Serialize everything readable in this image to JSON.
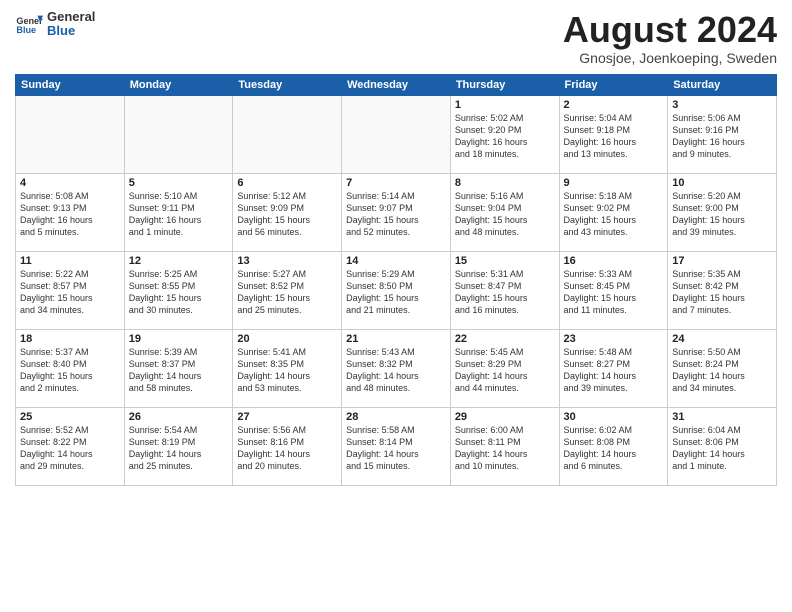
{
  "header": {
    "logo": {
      "general": "General",
      "blue": "Blue"
    },
    "title": "August 2024",
    "location": "Gnosjoe, Joenkoeping, Sweden"
  },
  "weekdays": [
    "Sunday",
    "Monday",
    "Tuesday",
    "Wednesday",
    "Thursday",
    "Friday",
    "Saturday"
  ],
  "weeks": [
    [
      {
        "day": "",
        "info": ""
      },
      {
        "day": "",
        "info": ""
      },
      {
        "day": "",
        "info": ""
      },
      {
        "day": "",
        "info": ""
      },
      {
        "day": "1",
        "info": "Sunrise: 5:02 AM\nSunset: 9:20 PM\nDaylight: 16 hours\nand 18 minutes."
      },
      {
        "day": "2",
        "info": "Sunrise: 5:04 AM\nSunset: 9:18 PM\nDaylight: 16 hours\nand 13 minutes."
      },
      {
        "day": "3",
        "info": "Sunrise: 5:06 AM\nSunset: 9:16 PM\nDaylight: 16 hours\nand 9 minutes."
      }
    ],
    [
      {
        "day": "4",
        "info": "Sunrise: 5:08 AM\nSunset: 9:13 PM\nDaylight: 16 hours\nand 5 minutes."
      },
      {
        "day": "5",
        "info": "Sunrise: 5:10 AM\nSunset: 9:11 PM\nDaylight: 16 hours\nand 1 minute."
      },
      {
        "day": "6",
        "info": "Sunrise: 5:12 AM\nSunset: 9:09 PM\nDaylight: 15 hours\nand 56 minutes."
      },
      {
        "day": "7",
        "info": "Sunrise: 5:14 AM\nSunset: 9:07 PM\nDaylight: 15 hours\nand 52 minutes."
      },
      {
        "day": "8",
        "info": "Sunrise: 5:16 AM\nSunset: 9:04 PM\nDaylight: 15 hours\nand 48 minutes."
      },
      {
        "day": "9",
        "info": "Sunrise: 5:18 AM\nSunset: 9:02 PM\nDaylight: 15 hours\nand 43 minutes."
      },
      {
        "day": "10",
        "info": "Sunrise: 5:20 AM\nSunset: 9:00 PM\nDaylight: 15 hours\nand 39 minutes."
      }
    ],
    [
      {
        "day": "11",
        "info": "Sunrise: 5:22 AM\nSunset: 8:57 PM\nDaylight: 15 hours\nand 34 minutes."
      },
      {
        "day": "12",
        "info": "Sunrise: 5:25 AM\nSunset: 8:55 PM\nDaylight: 15 hours\nand 30 minutes."
      },
      {
        "day": "13",
        "info": "Sunrise: 5:27 AM\nSunset: 8:52 PM\nDaylight: 15 hours\nand 25 minutes."
      },
      {
        "day": "14",
        "info": "Sunrise: 5:29 AM\nSunset: 8:50 PM\nDaylight: 15 hours\nand 21 minutes."
      },
      {
        "day": "15",
        "info": "Sunrise: 5:31 AM\nSunset: 8:47 PM\nDaylight: 15 hours\nand 16 minutes."
      },
      {
        "day": "16",
        "info": "Sunrise: 5:33 AM\nSunset: 8:45 PM\nDaylight: 15 hours\nand 11 minutes."
      },
      {
        "day": "17",
        "info": "Sunrise: 5:35 AM\nSunset: 8:42 PM\nDaylight: 15 hours\nand 7 minutes."
      }
    ],
    [
      {
        "day": "18",
        "info": "Sunrise: 5:37 AM\nSunset: 8:40 PM\nDaylight: 15 hours\nand 2 minutes."
      },
      {
        "day": "19",
        "info": "Sunrise: 5:39 AM\nSunset: 8:37 PM\nDaylight: 14 hours\nand 58 minutes."
      },
      {
        "day": "20",
        "info": "Sunrise: 5:41 AM\nSunset: 8:35 PM\nDaylight: 14 hours\nand 53 minutes."
      },
      {
        "day": "21",
        "info": "Sunrise: 5:43 AM\nSunset: 8:32 PM\nDaylight: 14 hours\nand 48 minutes."
      },
      {
        "day": "22",
        "info": "Sunrise: 5:45 AM\nSunset: 8:29 PM\nDaylight: 14 hours\nand 44 minutes."
      },
      {
        "day": "23",
        "info": "Sunrise: 5:48 AM\nSunset: 8:27 PM\nDaylight: 14 hours\nand 39 minutes."
      },
      {
        "day": "24",
        "info": "Sunrise: 5:50 AM\nSunset: 8:24 PM\nDaylight: 14 hours\nand 34 minutes."
      }
    ],
    [
      {
        "day": "25",
        "info": "Sunrise: 5:52 AM\nSunset: 8:22 PM\nDaylight: 14 hours\nand 29 minutes."
      },
      {
        "day": "26",
        "info": "Sunrise: 5:54 AM\nSunset: 8:19 PM\nDaylight: 14 hours\nand 25 minutes."
      },
      {
        "day": "27",
        "info": "Sunrise: 5:56 AM\nSunset: 8:16 PM\nDaylight: 14 hours\nand 20 minutes."
      },
      {
        "day": "28",
        "info": "Sunrise: 5:58 AM\nSunset: 8:14 PM\nDaylight: 14 hours\nand 15 minutes."
      },
      {
        "day": "29",
        "info": "Sunrise: 6:00 AM\nSunset: 8:11 PM\nDaylight: 14 hours\nand 10 minutes."
      },
      {
        "day": "30",
        "info": "Sunrise: 6:02 AM\nSunset: 8:08 PM\nDaylight: 14 hours\nand 6 minutes."
      },
      {
        "day": "31",
        "info": "Sunrise: 6:04 AM\nSunset: 8:06 PM\nDaylight: 14 hours\nand 1 minute."
      }
    ]
  ]
}
